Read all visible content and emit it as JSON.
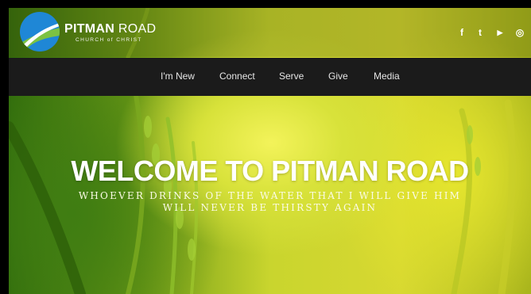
{
  "brand": {
    "title_bold": "PITMAN",
    "title_light": " ROAD",
    "subtitle": "CHURCH of CHRIST"
  },
  "social": [
    {
      "icon": "facebook-icon",
      "glyph": "f"
    },
    {
      "icon": "twitter-icon",
      "glyph": "t"
    },
    {
      "icon": "youtube-icon",
      "glyph": "▶"
    },
    {
      "icon": "instagram-icon",
      "glyph": "◎"
    }
  ],
  "nav": {
    "items": [
      {
        "label": "I'm New"
      },
      {
        "label": "Connect"
      },
      {
        "label": "Serve"
      },
      {
        "label": "Give"
      },
      {
        "label": "Media"
      }
    ]
  },
  "hero": {
    "title": "WELCOME TO PITMAN ROAD",
    "subtitle_line1": "WHOEVER DRINKS OF THE WATER THAT I WILL GIVE HIM",
    "subtitle_line2": "WILL NEVER BE THIRSTY AGAIN"
  },
  "colors": {
    "nav_bg": "#1b1b1b",
    "logo_blue": "#1f87d6",
    "logo_green": "#7cc242"
  }
}
